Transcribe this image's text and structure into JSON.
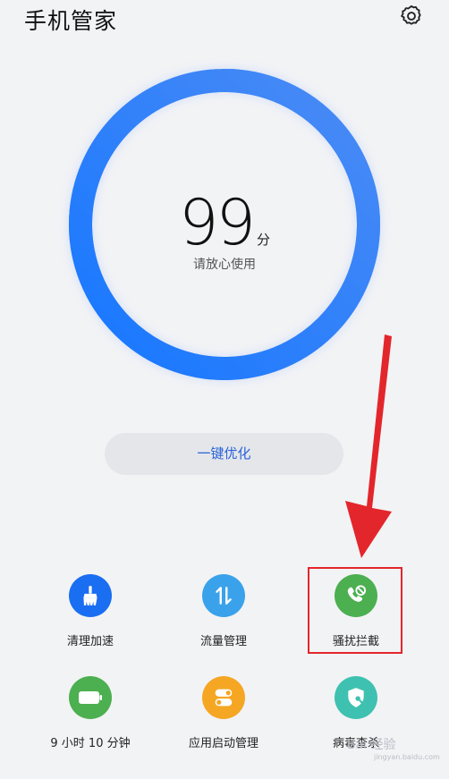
{
  "header": {
    "title": "手机管家",
    "settings_icon": "gear-icon"
  },
  "score": {
    "value": "99",
    "unit": "分",
    "status": "请放心使用",
    "percent": 99
  },
  "colors": {
    "ring_start": "#1677ff",
    "ring_end": "#4b8bf5",
    "accent": "#2a63d8",
    "highlight": "#e3262b"
  },
  "actions": {
    "optimize_label": "一键优化"
  },
  "tools": [
    {
      "label": "清理加速",
      "icon": "broom-icon",
      "color": "#1a6ef2"
    },
    {
      "label": "流量管理",
      "icon": "data-arrows-icon",
      "color": "#3aa2ea"
    },
    {
      "label": "骚扰拦截",
      "icon": "block-call-icon",
      "color": "#4caf50"
    },
    {
      "label": "9 小时 10 分钟",
      "icon": "battery-icon",
      "color": "#4caf50"
    },
    {
      "label": "应用启动管理",
      "icon": "app-toggle-icon",
      "color": "#f5a623"
    },
    {
      "label": "病毒查杀",
      "icon": "shield-scan-icon",
      "color": "#3ec1b0"
    }
  ],
  "watermark": {
    "text": "Bai 经验",
    "sub": "jingyan.baidu.com"
  }
}
